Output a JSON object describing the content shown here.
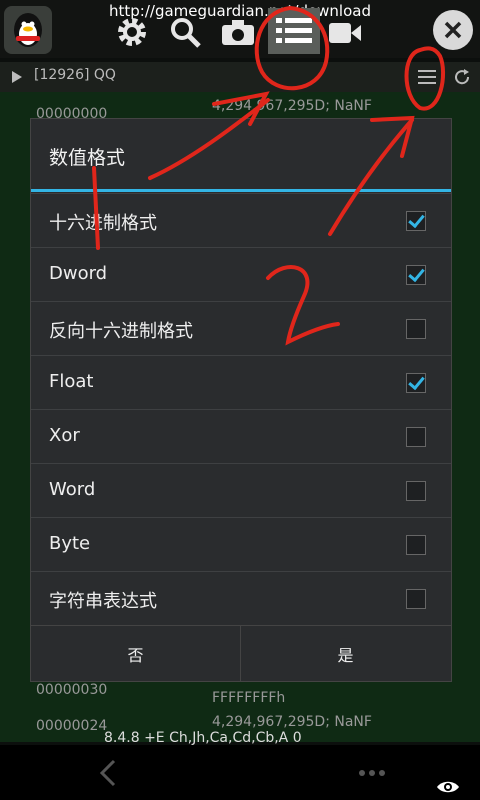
{
  "topbar": {
    "url": "http://gameguardian.net/download"
  },
  "process_bar": {
    "label": "[12926] QQ"
  },
  "background_rows": [
    {
      "address": "00000000",
      "value": "4,294,967,295D; NaNF"
    },
    {
      "address": "00000030",
      "value": "FFFFFFFFh"
    },
    {
      "address": "00000024",
      "value": "4,294,967,295D; NaNF"
    }
  ],
  "dialog": {
    "title": "数值格式",
    "options": [
      {
        "label": "十六进制格式",
        "checked": true
      },
      {
        "label": "Dword",
        "checked": true
      },
      {
        "label": "反向十六进制格式",
        "checked": false
      },
      {
        "label": "Float",
        "checked": true
      },
      {
        "label": "Xor",
        "checked": false
      },
      {
        "label": "Word",
        "checked": false
      },
      {
        "label": "Byte",
        "checked": false
      },
      {
        "label": "字符串表达式",
        "checked": false
      }
    ],
    "cancel_label": "否",
    "ok_label": "是"
  },
  "status_line": "8.4.8  +E  Ch,Jh,Ca,Cd,Cb,A  0",
  "colors": {
    "accent": "#33b5e5",
    "annotation": "#e0261b"
  }
}
